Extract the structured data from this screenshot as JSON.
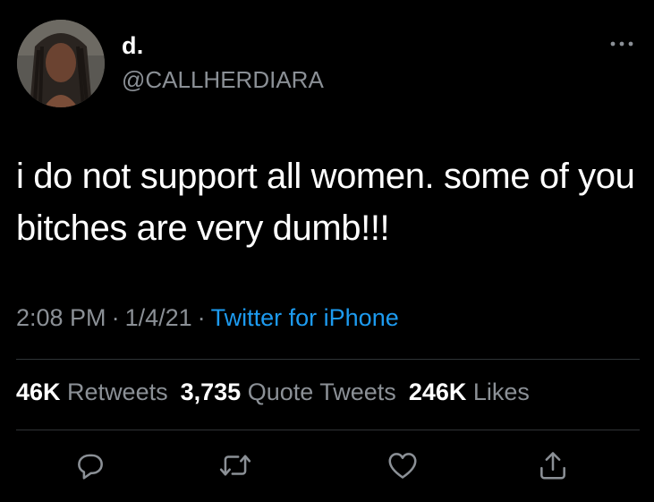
{
  "user": {
    "display_name": "d.",
    "handle": "@CALLHERDIARA"
  },
  "tweet": {
    "text": "i do not support all women. some of you bitches are very dumb!!!",
    "time": "2:08 PM",
    "date": "1/4/21",
    "separator": "·",
    "source": "Twitter for iPhone"
  },
  "stats": {
    "retweets_count": "46K",
    "retweets_label": "Retweets",
    "quotes_count": "3,735",
    "quotes_label": "Quote Tweets",
    "likes_count": "246K",
    "likes_label": "Likes"
  },
  "icons": {
    "more": "more-icon",
    "reply": "reply-icon",
    "retweet": "retweet-icon",
    "like": "like-icon",
    "share": "share-icon"
  },
  "colors": {
    "background": "#000000",
    "text": "#ffffff",
    "secondary": "#8b9096",
    "link": "#1d9bf0",
    "divider": "#2f3336"
  }
}
